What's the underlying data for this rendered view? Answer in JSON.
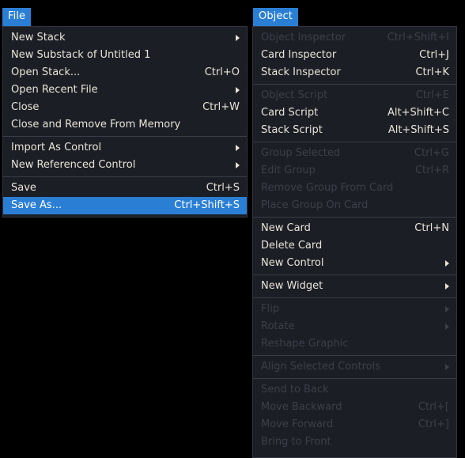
{
  "menubar": {
    "tabs": [
      {
        "label": "File",
        "active": true
      },
      {
        "label": "Object",
        "active": true
      }
    ]
  },
  "file_menu": {
    "groups": [
      {
        "items": [
          {
            "label": "New Stack",
            "accel": "",
            "submenu": true,
            "disabled": false,
            "selected": false
          },
          {
            "label": "New Substack of Untitled 1",
            "accel": "",
            "submenu": false,
            "disabled": false,
            "selected": false
          },
          {
            "label": "Open Stack...",
            "accel": "Ctrl+O",
            "submenu": false,
            "disabled": false,
            "selected": false
          },
          {
            "label": "Open Recent File",
            "accel": "",
            "submenu": true,
            "disabled": false,
            "selected": false
          },
          {
            "label": "Close",
            "accel": "Ctrl+W",
            "submenu": false,
            "disabled": false,
            "selected": false
          },
          {
            "label": "Close and Remove From Memory",
            "accel": "",
            "submenu": false,
            "disabled": false,
            "selected": false
          }
        ]
      },
      {
        "items": [
          {
            "label": "Import As Control",
            "accel": "",
            "submenu": true,
            "disabled": false,
            "selected": false
          },
          {
            "label": "New Referenced Control",
            "accel": "",
            "submenu": true,
            "disabled": false,
            "selected": false
          }
        ]
      },
      {
        "items": [
          {
            "label": "Save",
            "accel": "Ctrl+S",
            "submenu": false,
            "disabled": false,
            "selected": false
          },
          {
            "label": "Save As...",
            "accel": "Ctrl+Shift+S",
            "submenu": false,
            "disabled": false,
            "selected": true
          }
        ]
      }
    ]
  },
  "object_menu": {
    "groups": [
      {
        "items": [
          {
            "label": "Object Inspector",
            "accel": "Ctrl+Shift+I",
            "submenu": false,
            "disabled": true,
            "selected": false
          },
          {
            "label": "Card Inspector",
            "accel": "Ctrl+J",
            "submenu": false,
            "disabled": false,
            "selected": false
          },
          {
            "label": "Stack Inspector",
            "accel": "Ctrl+K",
            "submenu": false,
            "disabled": false,
            "selected": false
          }
        ]
      },
      {
        "items": [
          {
            "label": "Object Script",
            "accel": "Ctrl+E",
            "submenu": false,
            "disabled": true,
            "selected": false
          },
          {
            "label": "Card Script",
            "accel": "Alt+Shift+C",
            "submenu": false,
            "disabled": false,
            "selected": false
          },
          {
            "label": "Stack Script",
            "accel": "Alt+Shift+S",
            "submenu": false,
            "disabled": false,
            "selected": false
          }
        ]
      },
      {
        "items": [
          {
            "label": "Group Selected",
            "accel": "Ctrl+G",
            "submenu": false,
            "disabled": true,
            "selected": false
          },
          {
            "label": "Edit Group",
            "accel": "Ctrl+R",
            "submenu": false,
            "disabled": true,
            "selected": false
          },
          {
            "label": "Remove Group From Card",
            "accel": "",
            "submenu": false,
            "disabled": true,
            "selected": false
          },
          {
            "label": "Place Group On Card",
            "accel": "",
            "submenu": false,
            "disabled": true,
            "selected": false
          }
        ]
      },
      {
        "items": [
          {
            "label": "New Card",
            "accel": "Ctrl+N",
            "submenu": false,
            "disabled": false,
            "selected": false
          },
          {
            "label": "Delete Card",
            "accel": "",
            "submenu": false,
            "disabled": false,
            "selected": false
          },
          {
            "label": "New Control",
            "accel": "",
            "submenu": true,
            "disabled": false,
            "selected": false
          }
        ]
      },
      {
        "items": [
          {
            "label": "New Widget",
            "accel": "",
            "submenu": true,
            "disabled": false,
            "selected": false
          }
        ]
      },
      {
        "items": [
          {
            "label": "Flip",
            "accel": "",
            "submenu": true,
            "disabled": true,
            "selected": false
          },
          {
            "label": "Rotate",
            "accel": "",
            "submenu": true,
            "disabled": true,
            "selected": false
          },
          {
            "label": "Reshape Graphic",
            "accel": "",
            "submenu": false,
            "disabled": true,
            "selected": false
          }
        ]
      },
      {
        "items": [
          {
            "label": "Align Selected Controls",
            "accel": "",
            "submenu": true,
            "disabled": true,
            "selected": false
          }
        ]
      },
      {
        "items": [
          {
            "label": "Send to Back",
            "accel": "",
            "submenu": false,
            "disabled": true,
            "selected": false
          },
          {
            "label": "Move Backward",
            "accel": "Ctrl+[",
            "submenu": false,
            "disabled": true,
            "selected": false
          },
          {
            "label": "Move Forward",
            "accel": "Ctrl+]",
            "submenu": false,
            "disabled": true,
            "selected": false
          },
          {
            "label": "Bring to Front",
            "accel": "",
            "submenu": false,
            "disabled": true,
            "selected": false
          }
        ]
      }
    ]
  },
  "colors": {
    "background": "#000000",
    "panel_bg": "#1c1e26",
    "panel_border": "#33363f",
    "text_enabled": "#e9e4d6",
    "text_disabled": "#3c3f4a",
    "highlight": "#2a7fd4",
    "separator": "#3a3d47"
  }
}
